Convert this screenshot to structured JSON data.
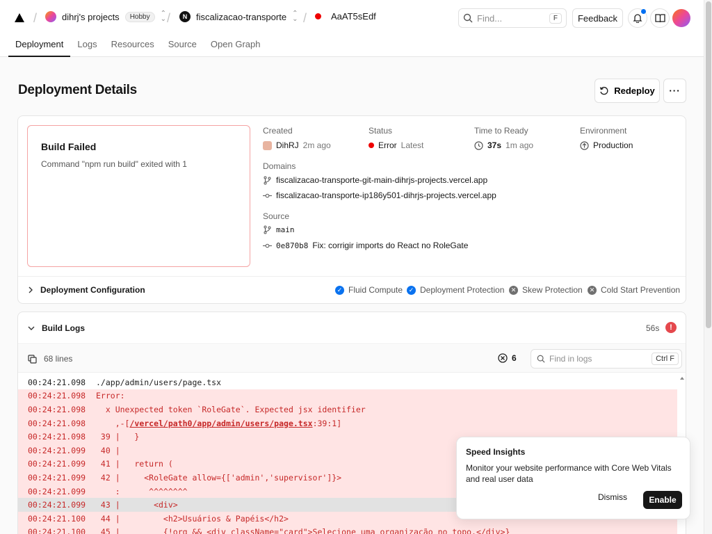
{
  "header": {
    "team": "dihrj's projects",
    "plan": "Hobby",
    "project": "fiscalizacao-transporte",
    "deployment": "AaAT5sEdf",
    "search_placeholder": "Find...",
    "search_shortcut": "F",
    "feedback": "Feedback"
  },
  "tabs": [
    "Deployment",
    "Logs",
    "Resources",
    "Source",
    "Open Graph"
  ],
  "page": {
    "title": "Deployment Details",
    "redeploy": "Redeploy",
    "more": "···"
  },
  "summary": {
    "fail_title": "Build Failed",
    "fail_message": "Command \"npm run build\" exited with 1",
    "created_label": "Created",
    "created_user": "DihRJ",
    "created_time": "2m ago",
    "status_label": "Status",
    "status_value": "Error",
    "status_tag": "Latest",
    "ready_label": "Time to Ready",
    "ready_value": "37s",
    "ready_ago": "1m ago",
    "env_label": "Environment",
    "env_value": "Production",
    "domains_label": "Domains",
    "domains": [
      "fiscalizacao-transporte-git-main-dihrjs-projects.vercel.app",
      "fiscalizacao-transporte-ip186y501-dihrjs-projects.vercel.app"
    ],
    "source_label": "Source",
    "branch": "main",
    "commit_hash": "0e870b8",
    "commit_msg": "Fix: corrigir imports do React no RoleGate"
  },
  "config": {
    "title": "Deployment Configuration",
    "features": [
      {
        "label": "Fluid Compute",
        "enabled": true
      },
      {
        "label": "Deployment Protection",
        "enabled": true
      },
      {
        "label": "Skew Protection",
        "enabled": false
      },
      {
        "label": "Cold Start Prevention",
        "enabled": false
      }
    ]
  },
  "build_logs": {
    "title": "Build Logs",
    "duration": "56s",
    "lines_count": "68 lines",
    "error_count": "6",
    "search_placeholder": "Find in logs",
    "search_shortcut": "Ctrl F",
    "lines": [
      {
        "ts": "00:24:21.098",
        "text": "./app/admin/users/page.tsx",
        "kind": "plain"
      },
      {
        "ts": "00:24:21.098",
        "text": "Error:",
        "kind": "err"
      },
      {
        "ts": "00:24:21.098",
        "text": "  x Unexpected token `RoleGate`. Expected jsx identifier",
        "kind": "err"
      },
      {
        "ts": "00:24:21.098",
        "text": "    ,-[",
        "link": "/vercel/path0/app/admin/users/page.tsx",
        "after": ":39:1]",
        "kind": "err"
      },
      {
        "ts": "00:24:21.098",
        "text": " 39 |   }",
        "kind": "err"
      },
      {
        "ts": "00:24:21.099",
        "text": " 40 |",
        "kind": "err"
      },
      {
        "ts": "00:24:21.099",
        "text": " 41 |   return (",
        "kind": "err"
      },
      {
        "ts": "00:24:21.099",
        "text": " 42 |     <RoleGate allow={['admin','supervisor']}>",
        "kind": "err"
      },
      {
        "ts": "00:24:21.099",
        "text": "    :      ^^^^^^^^",
        "kind": "err"
      },
      {
        "ts": "00:24:21.099",
        "text": " 43 |       <div>",
        "kind": "sel"
      },
      {
        "ts": "00:24:21.100",
        "text": " 44 |         <h2>Usuários & Papéis</h2>",
        "kind": "err"
      },
      {
        "ts": "00:24:21.100",
        "text": " 45 |         {!org && <div className=\"card\">Selecione uma organização no topo.</div>}",
        "kind": "err"
      }
    ]
  },
  "speed_insights": {
    "title": "Speed Insights",
    "body": "Monitor your website performance with Core Web Vitals and real user data",
    "dismiss": "Dismiss",
    "enable": "Enable"
  }
}
